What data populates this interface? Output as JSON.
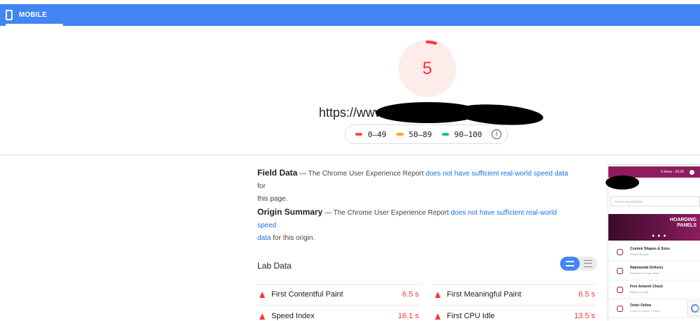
{
  "header": {
    "tab_label": "MOBILE",
    "tab_icon": "phone-icon"
  },
  "score": {
    "value": "5",
    "fraction": 0.05,
    "color": "#ff3333",
    "bg": "#fdecea"
  },
  "url_text": "https://www",
  "legend": [
    {
      "label": "0–49",
      "color": "#ff4e42"
    },
    {
      "label": "50–89",
      "color": "#ffa400"
    },
    {
      "label": "90–100",
      "color": "#0cce6b"
    }
  ],
  "legend_info_icon": "info-icon",
  "field_data": {
    "title": "Field Data",
    "dash": " — The Chrome User Experience Report ",
    "link": "does not have sufficient real-world speed data",
    "tail1": " for",
    "tail2": "this page."
  },
  "origin_summary": {
    "title": "Origin Summary",
    "dash": " — The Chrome User Experience Report ",
    "link1": "does not have sufficient real-world speed",
    "link2": "data",
    "tail": " for this origin."
  },
  "lab_data": {
    "title": "Lab Data",
    "metrics": [
      {
        "name": "First Contentful Paint",
        "value": "6.5 s"
      },
      {
        "name": "First Meaningful Paint",
        "value": "6.5 s"
      },
      {
        "name": "Speed Index",
        "value": "16.1 s"
      },
      {
        "name": "First CPU Idle",
        "value": "13.5 s"
      }
    ]
  },
  "thumbnail": {
    "cart_text": "0 items - £0.00",
    "search_placeholder": "Search Boards/Sign",
    "banner_line1": "HOARDING",
    "banner_line2": "PANELS",
    "items": [
      {
        "title": "Custom Shapes & Sizes",
        "sub": "Printed Boards"
      },
      {
        "title": "Nationwide Delivery",
        "sub": "Standard & Large Items"
      },
      {
        "title": "Free Artwork Check",
        "sub": "Before printing"
      },
      {
        "title": "Order Online",
        "sub": "Order 24 Hours, 7 Days"
      }
    ]
  }
}
